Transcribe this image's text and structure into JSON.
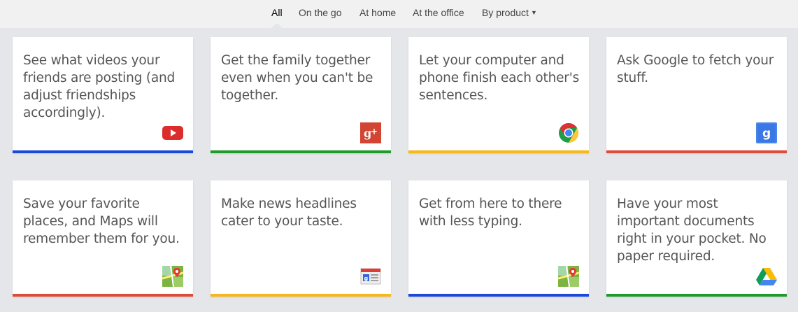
{
  "nav": {
    "tabs": [
      {
        "label": "All",
        "active": true
      },
      {
        "label": "On the go"
      },
      {
        "label": "At home"
      },
      {
        "label": "At the office"
      },
      {
        "label": "By product",
        "dropdown": true
      }
    ]
  },
  "colors": {
    "blue": "#1a48d8",
    "green": "#1f9a2b",
    "yellow": "#f5b91e",
    "red": "#dd4b39"
  },
  "cards": [
    {
      "text": "See what videos your friends are posting (and adjust friendships accordingly).",
      "icon": "youtube-icon",
      "accent": "#1a48d8"
    },
    {
      "text": "Get the family together even when you can't be together.",
      "icon": "google-plus-icon",
      "accent": "#1f9a2b"
    },
    {
      "text": "Let your computer and phone finish each other's sentences.",
      "icon": "chrome-icon",
      "accent": "#f5b91e"
    },
    {
      "text": "Ask Google to fetch your stuff.",
      "icon": "google-search-icon",
      "accent": "#dd4b39"
    },
    {
      "text": "Save your favorite places, and Maps will remember them for you.",
      "icon": "google-maps-icon",
      "accent": "#dd4b39"
    },
    {
      "text": "Make news headlines cater to your taste.",
      "icon": "google-news-icon",
      "accent": "#f5b91e"
    },
    {
      "text": "Get from here to there with less typing.",
      "icon": "google-maps-icon",
      "accent": "#1a48d8"
    },
    {
      "text": "Have your most important documents right in your pocket. No paper required.",
      "icon": "google-drive-icon",
      "accent": "#1f9a2b"
    }
  ]
}
